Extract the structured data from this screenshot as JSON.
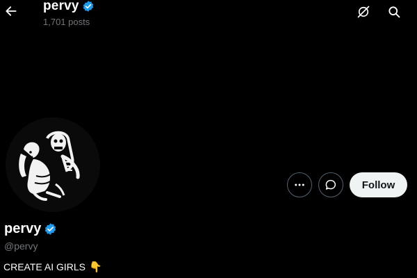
{
  "header": {
    "title": "pervy",
    "post_count": "1,701 posts",
    "back_icon": "arrow-left-icon",
    "grok_icon": "grok-icon",
    "search_icon": "search-icon"
  },
  "profile": {
    "display_name": "pervy",
    "handle": "@pervy",
    "verified": true,
    "verified_color": "#1d9bf0",
    "bio_text": "CREATE AI GIRLS",
    "bio_emoji": "👇"
  },
  "actions": {
    "more_icon": "more-horizontal-icon",
    "message_icon": "message-bubble-icon",
    "follow_label": "Follow"
  }
}
